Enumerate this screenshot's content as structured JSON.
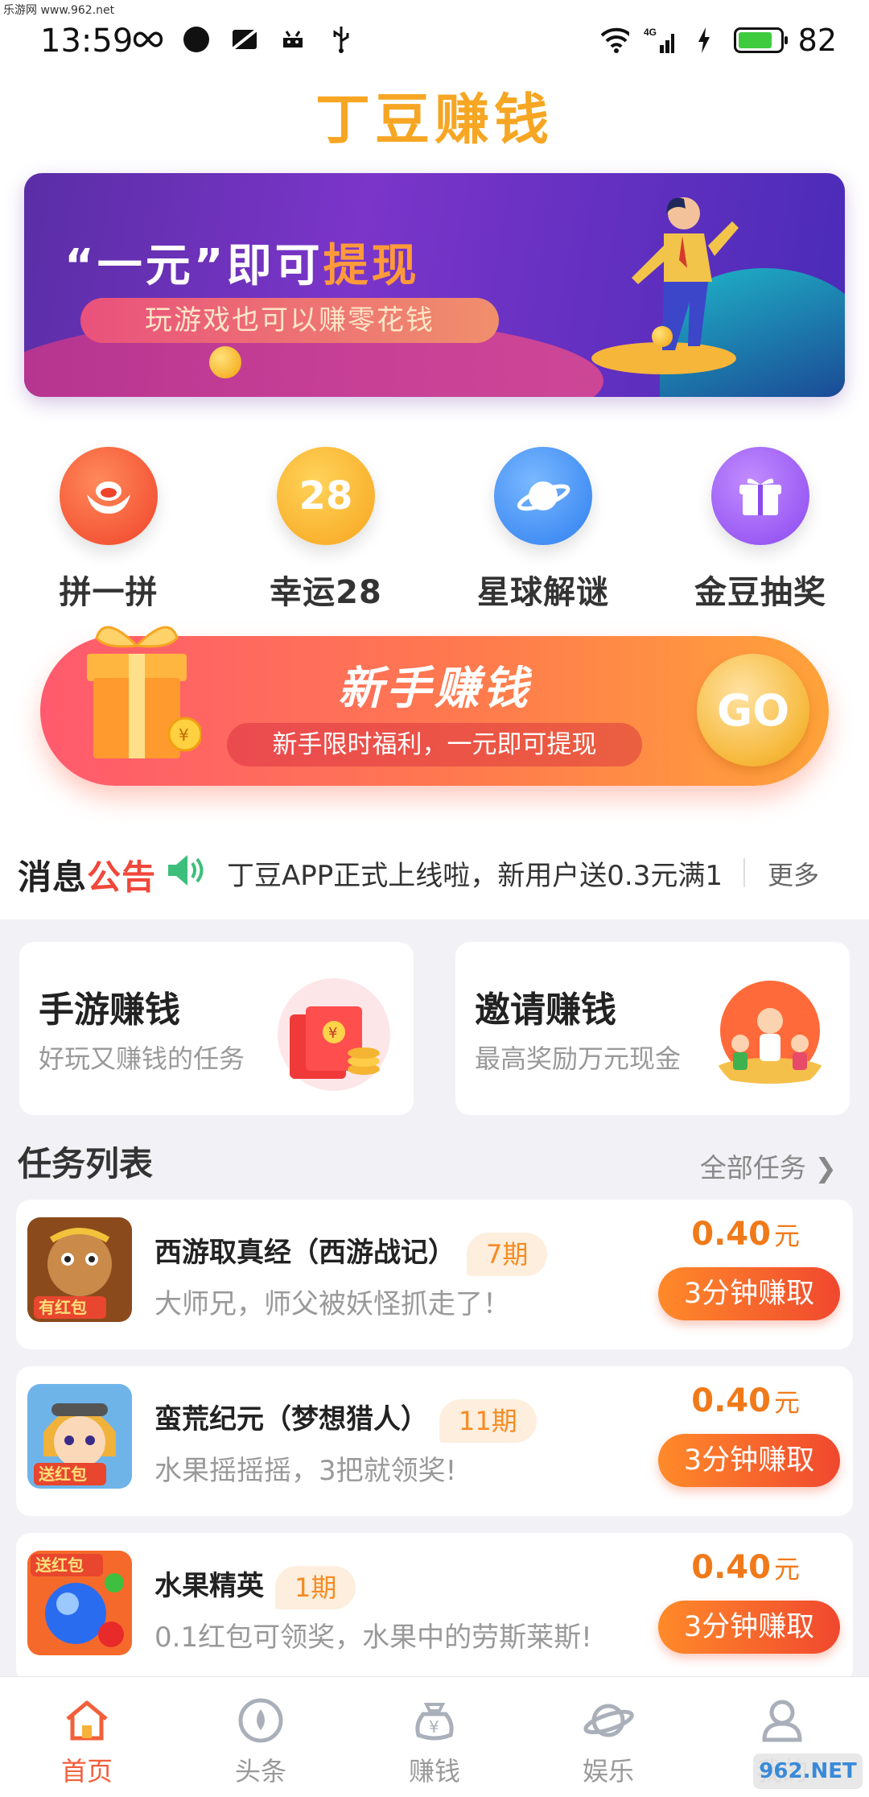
{
  "status_bar": {
    "watermark": "乐游网 www.962.net",
    "time": "13:59",
    "network": "4G",
    "battery": "82",
    "battery_level": 0.82
  },
  "app": {
    "title": "丁豆赚钱"
  },
  "banner": {
    "headline_part1": "“一元”即可",
    "headline_highlight": "提现",
    "subtitle": "玩游戏也可以赚零花钱"
  },
  "quick_entries": [
    {
      "label": "拼一拼",
      "icon": "ingot-icon",
      "color": "#f5542f"
    },
    {
      "label": "幸运28",
      "icon_text": "28",
      "icon": "lucky-28-icon",
      "color": "#f9b62a"
    },
    {
      "label": "星球解谜",
      "icon": "planet-icon",
      "color": "#3e8ef2"
    },
    {
      "label": "金豆抽奖",
      "icon": "gift-icon",
      "color": "#9a5cf0"
    }
  ],
  "newbie": {
    "title": "新手赚钱",
    "subtitle": "新手限时福利，一元即可提现",
    "go": "GO"
  },
  "notice": {
    "title_black": "消息",
    "title_red": "公告",
    "text": "丁豆APP正式上线啦，新用户送0.3元满1",
    "more": "更多"
  },
  "promo_cards": [
    {
      "title": "手游赚钱",
      "subtitle": "好玩又赚钱的任务",
      "icon": "red-envelope-icon"
    },
    {
      "title": "邀请赚钱",
      "subtitle": "最高奖励万元现金",
      "icon": "family-icon"
    }
  ],
  "task_section": {
    "title": "任务列表",
    "all": "全部任务"
  },
  "tasks": [
    {
      "name": "西游取真经（西游战记）",
      "period": "7期",
      "desc": "大师兄，师父被妖怪抓走了！",
      "reward": "0.40",
      "unit": "元",
      "button": "3分钟赚取",
      "thumb_badge": "有红包"
    },
    {
      "name": "蛮荒纪元（梦想猎人）",
      "period": "11期",
      "desc": "水果摇摇摇，3把就领奖!",
      "reward": "0.40",
      "unit": "元",
      "button": "3分钟赚取",
      "thumb_badge": "送红包"
    },
    {
      "name": "水果精英",
      "period": "1期",
      "desc": "0.1红包可领奖，水果中的劳斯莱斯!",
      "reward": "0.40",
      "unit": "元",
      "button": "3分钟赚取",
      "thumb_badge": "送红包"
    }
  ],
  "bottom_nav": [
    {
      "label": "首页",
      "icon": "home-icon",
      "active": true
    },
    {
      "label": "头条",
      "icon": "headline-icon",
      "active": false
    },
    {
      "label": "赚钱",
      "icon": "money-bag-icon",
      "active": false
    },
    {
      "label": "娱乐",
      "icon": "planet-icon",
      "active": false
    },
    {
      "label": "我的",
      "icon": "profile-icon",
      "active": false
    }
  ],
  "watermark_bottom": "962.NET",
  "colors": {
    "accent_orange": "#f6a623",
    "reward_orange": "#f07a1a",
    "active_nav": "#f25f3a"
  }
}
